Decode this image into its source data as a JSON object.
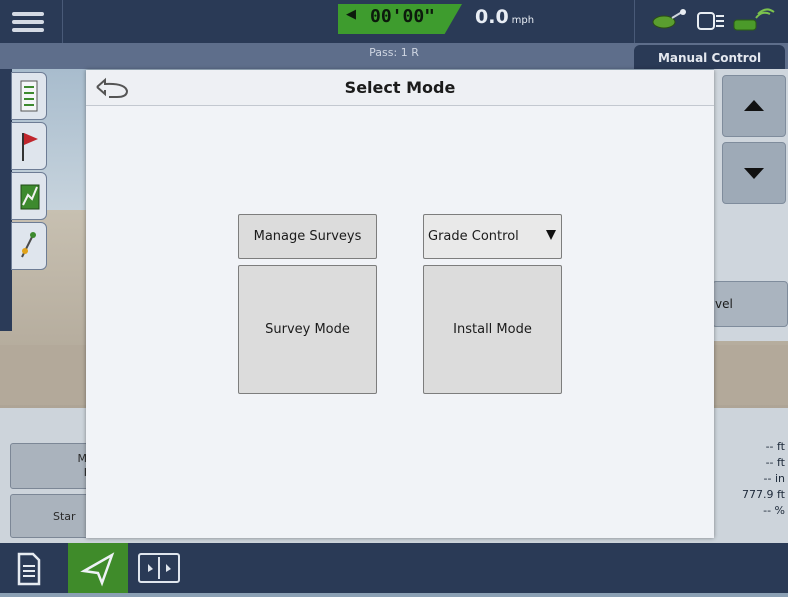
{
  "topbar": {
    "timer": "00'00\"",
    "speed_value": "0.0",
    "speed_unit": "mph",
    "timer_arrow": "◀"
  },
  "subbar": {
    "pass_label": "Pass: 1 R",
    "manual_control_tab": "Manual Control"
  },
  "right_panel": {
    "level_button_partial": "vel"
  },
  "info": {
    "values": [
      "-- ft",
      "-- ft",
      "-- in",
      "777.9 ft",
      "-- %"
    ],
    "left_button_top": "M\nI",
    "left_button_bottom": "Star"
  },
  "modal": {
    "title": "Select Mode",
    "manage_surveys": "Manage Surveys",
    "grade_control_selected": "Grade Control",
    "survey_mode": "Survey Mode",
    "install_mode": "Install Mode"
  },
  "icons": {
    "menu": "hamburger-icon",
    "back": "back-arrow-icon",
    "tools": [
      "layers-icon",
      "flag-icon",
      "chart-icon",
      "pin-icon"
    ],
    "nav": [
      "document-icon",
      "guidance-icon",
      "split-view-icon"
    ],
    "status": [
      "ready-icon",
      "device-icon",
      "gps-icon"
    ]
  },
  "colors": {
    "topbar": "#2a3a56",
    "speed_green": "#3e9c2e",
    "nav_active": "#3f8b2a",
    "modal_bg": "#f1f3f7"
  }
}
